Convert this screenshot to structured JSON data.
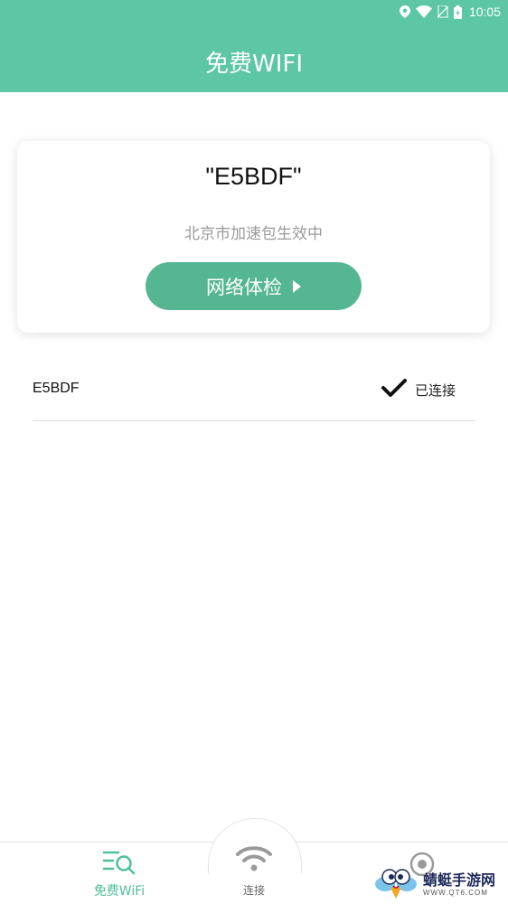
{
  "status_bar": {
    "time": "10:05",
    "icons": [
      "location-icon",
      "wifi-icon",
      "no-sim-icon",
      "battery-icon"
    ]
  },
  "header": {
    "title": "免费WIFI",
    "background": "#5cc6a5"
  },
  "card": {
    "ssid_title": "\"E5BDF\"",
    "accelerate_text": "北京市加速包生效中",
    "check_button_label": "网络体检",
    "button_color": "#55b692"
  },
  "network_list": {
    "items": [
      {
        "name": "E5BDF",
        "status": "已连接"
      }
    ]
  },
  "bottom_nav": {
    "items": [
      {
        "label": "免费WiFi",
        "icon": "wifi-search-icon",
        "active": true
      },
      {
        "label": "连接",
        "icon": "wifi-icon",
        "active": false
      },
      {
        "label": "",
        "icon": "target-icon",
        "active": false
      }
    ],
    "active_color": "#4fbf9a"
  },
  "watermark": {
    "brand": "蜻蜓手游网",
    "url": "WWW.QT6.COM"
  }
}
